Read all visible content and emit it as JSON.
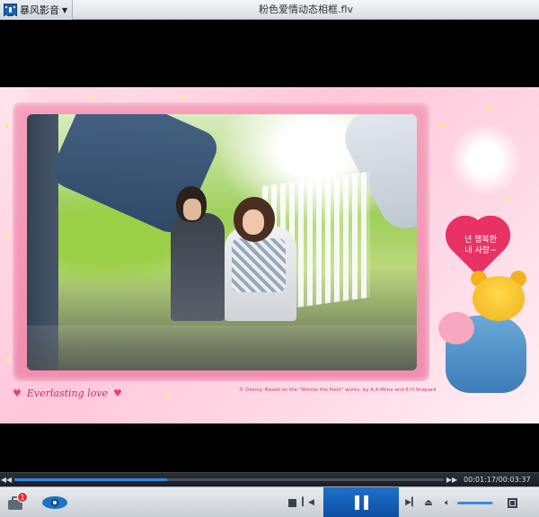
{
  "app": {
    "name": "暴风影音",
    "window_title": "粉色爱情动态相框.flv"
  },
  "video": {
    "overlay_tagline": "Everlasting love",
    "overlay_credit": "© Disney. Based on the \"Winnie the Pooh\" works, by A.A.Milne and E.H.Shepard",
    "heart_text_line1": "넌 행복한",
    "heart_text_line2": "내 사랑~"
  },
  "playback": {
    "current_time": "00:01:17",
    "total_time": "00:03:37",
    "time_display": "00:01:17/00:03:37",
    "progress_fraction": 0.355,
    "volume_fraction": 0.98,
    "state": "playing"
  },
  "toolbox": {
    "badge_count": "1"
  },
  "icons": {
    "app_logo": "film-strip-icon",
    "toolbox": "toolbox-icon",
    "eye": "eye-icon",
    "stop": "stop-icon",
    "previous": "previous-icon",
    "pause": "pause-icon",
    "next": "next-icon",
    "eject": "eject-icon",
    "volume": "speaker-icon",
    "fullscreen": "fullscreen-icon",
    "seek_back": "rewind-icon",
    "seek_forward": "fast-forward-icon"
  },
  "colors": {
    "accent": "#1f6fc9",
    "progress": "#2f8be6",
    "badge": "#e12b2b",
    "frame_pink": "#f28db0"
  }
}
